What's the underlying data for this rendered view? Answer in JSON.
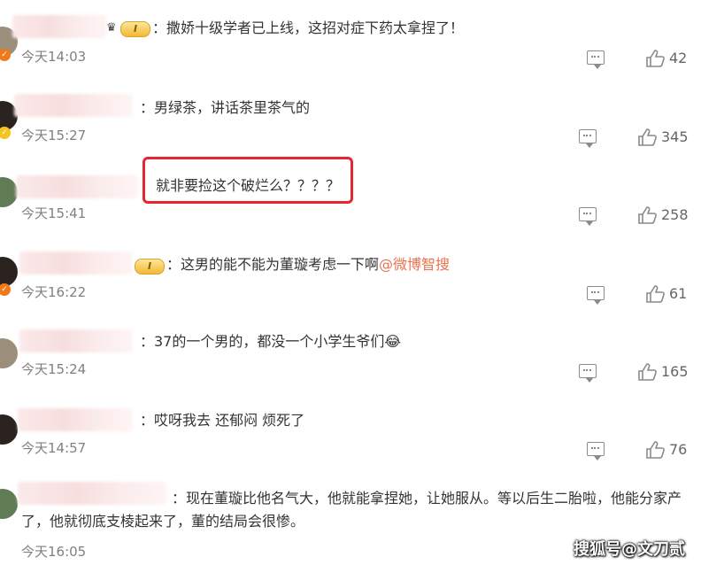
{
  "comments": [
    {
      "text": "：撒娇十级学者已上线，这招对症下药太拿捏了！",
      "time": "今天14:03",
      "likes": "42",
      "level": "I"
    },
    {
      "text": "：男绿茶，讲话茶里茶气的",
      "time": "今天15:27",
      "likes": "345"
    },
    {
      "text": "就非要捡这个破烂么？？？？",
      "time": "今天15:41",
      "likes": "258"
    },
    {
      "text": "：这男的能不能为董璇考虑一下啊",
      "mention": "@微博智搜",
      "time": "今天16:22",
      "likes": "61",
      "level": "I"
    },
    {
      "text": "：37的一个男的，都没一个小学生爷们",
      "emoji": "😂",
      "time": "今天15:24",
      "likes": "165"
    },
    {
      "text": "：哎呀我去 还郁闷 烦死了",
      "time": "今天14:57",
      "likes": "76"
    },
    {
      "text": "：现在董璇比他名气大，他就能拿捏她，让她服从。等以后生二胎啦，他能分家产了，他就彻底支棱起来了，董的结局会很惨。",
      "time": "今天16:05",
      "likes": ""
    }
  ],
  "watermark": "搜狐号@文刀贰",
  "icons": {
    "reply": "reply-icon",
    "like": "thumbs-up-icon"
  },
  "colors": {
    "highlight": "#e6262f",
    "mention": "#eb7350",
    "time": "#808080"
  }
}
